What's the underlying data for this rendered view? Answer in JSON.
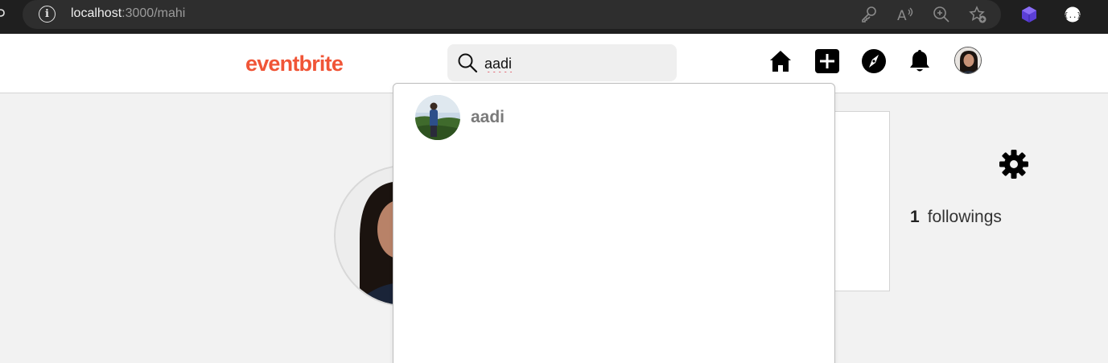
{
  "browser": {
    "url_host": "localhost",
    "url_rest": ":3000/mahi",
    "info_glyph": "i"
  },
  "header": {
    "logo": "eventbrite",
    "search": {
      "value": "aadi",
      "placeholder": "Search"
    }
  },
  "search_results": [
    {
      "name": "aadi"
    }
  ],
  "profile": {
    "followings_count": "1",
    "followings_label": "followings"
  },
  "colors": {
    "brand": "#f05537",
    "chrome_bg": "#1f1f1f",
    "page_bg": "#f2f2f2"
  }
}
